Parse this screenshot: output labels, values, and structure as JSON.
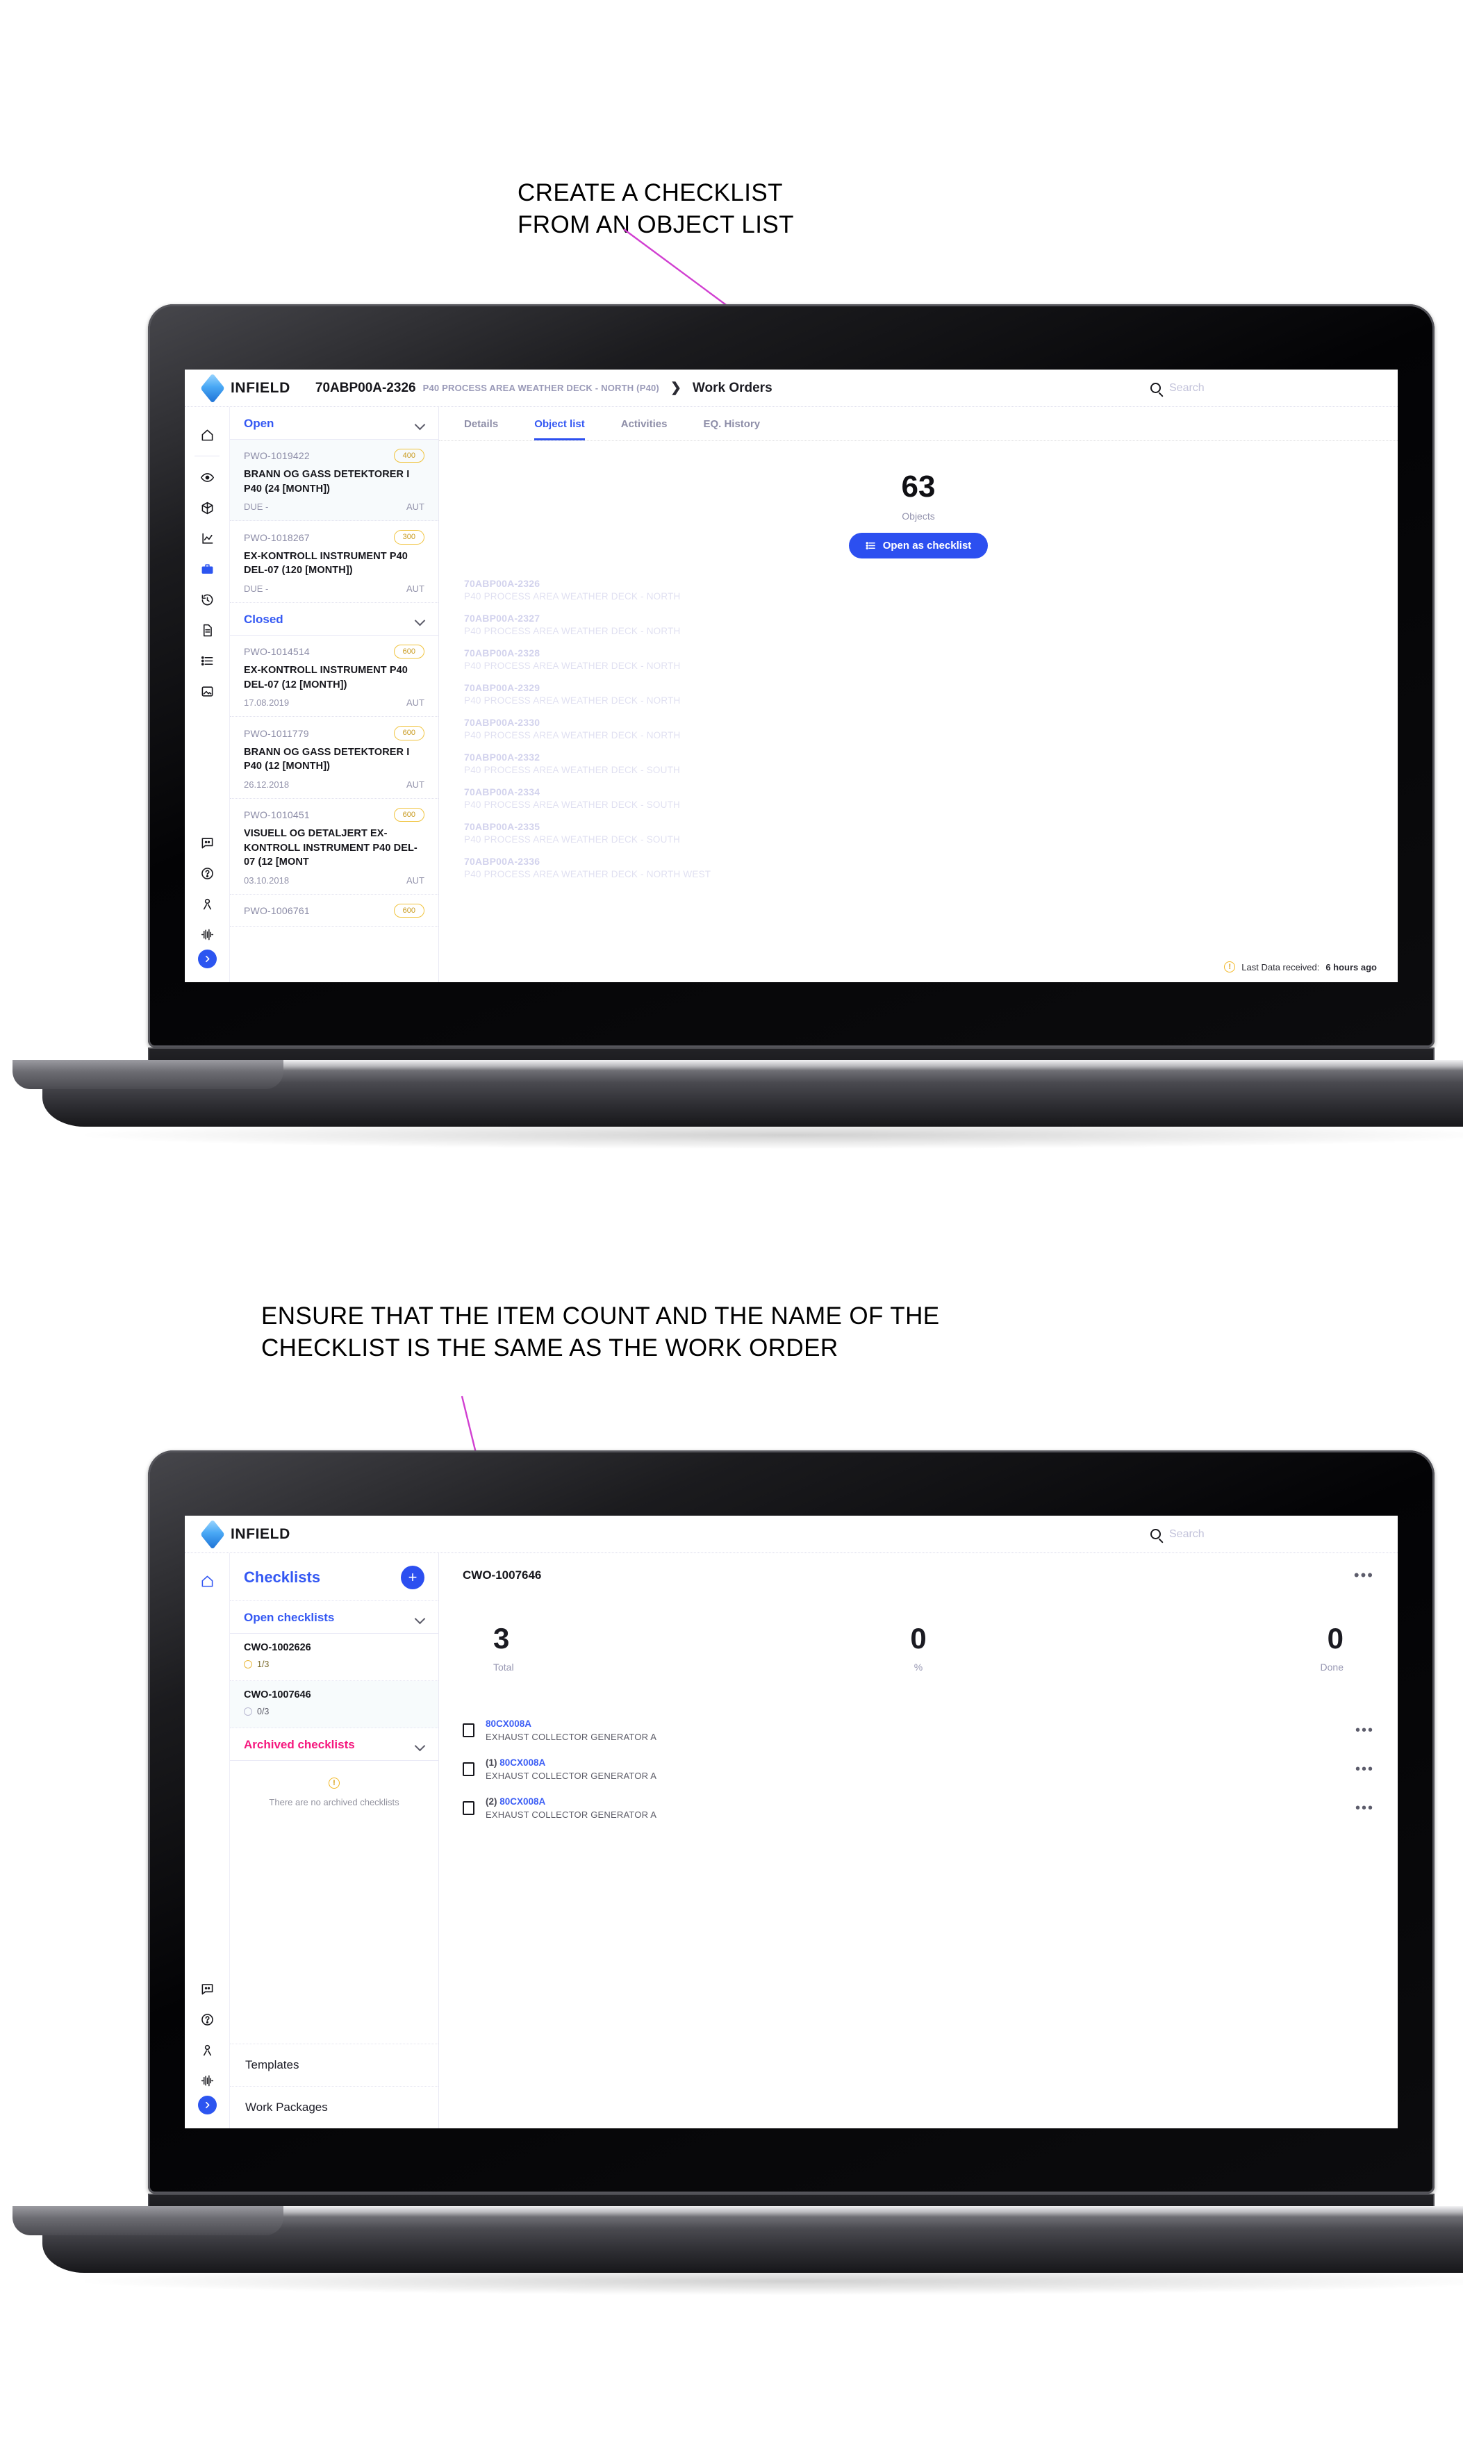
{
  "annotations": [
    {
      "id": "annotation-create-checklist",
      "text": "CREATE A CHECKLIST\nFROM AN OBJECT LIST",
      "color": "#d13fd1"
    },
    {
      "id": "annotation-item-count",
      "text": "ENSURE THAT THE ITEM COUNT AND THE NAME OF THE\nCHECKLIST IS THE SAME AS THE WORK ORDER",
      "color": "#d13fd1"
    }
  ],
  "screen1": {
    "appbar": {
      "logo_text": "INFIELD",
      "breadcrumb_code": "70ABP00A-2326",
      "breadcrumb_desc": "P40 PROCESS AREA WEATHER DECK - NORTH (P40)",
      "breadcrumb_sep": "❯",
      "breadcrumb_leaf": "Work Orders",
      "search_placeholder": "Search"
    },
    "rail": [
      {
        "name": "home-icon"
      },
      {
        "name": "eye-icon"
      },
      {
        "name": "cube-icon"
      },
      {
        "name": "chart-icon"
      },
      {
        "name": "toolbox-icon",
        "active": true
      },
      {
        "name": "history-icon"
      },
      {
        "name": "document-icon"
      },
      {
        "name": "list-icon"
      },
      {
        "name": "image-icon"
      },
      {
        "name": "message-icon"
      },
      {
        "name": "help-icon"
      },
      {
        "name": "person-icon"
      },
      {
        "name": "waveform-icon"
      },
      {
        "name": "collapse-icon"
      }
    ],
    "groups": [
      {
        "label": "Open",
        "id": "group-open"
      },
      {
        "label": "Closed",
        "id": "group-closed"
      }
    ],
    "work_orders_open": [
      {
        "id": "PWO-1019422",
        "badge": "400",
        "title": "BRANN OG GASS DETEKTORER I P40 (24 [MONTH])",
        "date": "DUE -",
        "aut": "AUT",
        "selected": true
      },
      {
        "id": "PWO-1018267",
        "badge": "300",
        "title": "EX-KONTROLL INSTRUMENT P40 DEL-07 (120 [MONTH])",
        "date": "DUE -",
        "aut": "AUT",
        "selected": false
      }
    ],
    "work_orders_closed": [
      {
        "id": "PWO-1014514",
        "badge": "600",
        "title": "EX-KONTROLL INSTRUMENT P40 DEL-07 (12 [MONTH])",
        "date": "17.08.2019",
        "aut": "AUT"
      },
      {
        "id": "PWO-1011779",
        "badge": "600",
        "title": "BRANN OG GASS DETEKTORER I P40 (12 [MONTH])",
        "date": "26.12.2018",
        "aut": "AUT"
      },
      {
        "id": "PWO-1010451",
        "badge": "600",
        "title": "VISUELL OG DETALJERT EX-KONTROLL INSTRUMENT P40 DEL-07 (12 [MONT",
        "date": "03.10.2018",
        "aut": "AUT"
      },
      {
        "id": "PWO-1006761",
        "badge": "600",
        "title": "",
        "date": "",
        "aut": ""
      }
    ],
    "tabs": [
      {
        "label": "Details",
        "active": false
      },
      {
        "label": "Object list",
        "active": true
      },
      {
        "label": "Activities",
        "active": false
      },
      {
        "label": "EQ. History",
        "active": false
      }
    ],
    "kpi": {
      "value": "63",
      "label": "Objects"
    },
    "primary_button": {
      "label": "Open as checklist",
      "icon": "list-icon"
    },
    "objects": [
      {
        "code": "70ABP00A-2326",
        "desc": "P40 PROCESS AREA WEATHER DECK - NORTH"
      },
      {
        "code": "70ABP00A-2327",
        "desc": "P40 PROCESS AREA WEATHER DECK - NORTH"
      },
      {
        "code": "70ABP00A-2328",
        "desc": "P40 PROCESS AREA WEATHER DECK - NORTH"
      },
      {
        "code": "70ABP00A-2329",
        "desc": "P40 PROCESS AREA WEATHER DECK - NORTH"
      },
      {
        "code": "70ABP00A-2330",
        "desc": "P40 PROCESS AREA WEATHER DECK - NORTH"
      },
      {
        "code": "70ABP00A-2332",
        "desc": "P40 PROCESS AREA WEATHER DECK - SOUTH"
      },
      {
        "code": "70ABP00A-2334",
        "desc": "P40 PROCESS AREA WEATHER DECK - SOUTH"
      },
      {
        "code": "70ABP00A-2335",
        "desc": "P40 PROCESS AREA WEATHER DECK - SOUTH"
      },
      {
        "code": "70ABP00A-2336",
        "desc": "P40 PROCESS AREA WEATHER DECK - NORTH WEST"
      }
    ],
    "status": {
      "prefix": "Last Data received:",
      "value": "6 hours ago",
      "icon": "warning-icon"
    }
  },
  "screen2": {
    "appbar": {
      "logo_text": "INFIELD",
      "search_placeholder": "Search"
    },
    "sidebar": {
      "title": "Checklists",
      "add_label": "+",
      "open_group": "Open checklists",
      "archived_group": "Archived checklists",
      "checklists": [
        {
          "id": "CWO-1002626",
          "progress": "1/3",
          "state": "partial",
          "selected": false
        },
        {
          "id": "CWO-1007646",
          "progress": "0/3",
          "state": "none",
          "selected": true
        }
      ],
      "archived_empty": "There are no archived checklists",
      "nav": [
        {
          "label": "Templates"
        },
        {
          "label": "Work Packages"
        }
      ]
    },
    "panel": {
      "checklist_id": "CWO-1007646",
      "menu_icon": "•••",
      "stats": [
        {
          "value": "3",
          "label": "Total"
        },
        {
          "value": "0",
          "label": "%"
        },
        {
          "value": "0",
          "label": "Done"
        }
      ],
      "items": [
        {
          "prefix": "",
          "code": "80CX008A",
          "desc": "EXHAUST COLLECTOR GENERATOR A"
        },
        {
          "prefix": "(1) ",
          "code": "80CX008A",
          "desc": "EXHAUST COLLECTOR GENERATOR A"
        },
        {
          "prefix": "(2) ",
          "code": "80CX008A",
          "desc": "EXHAUST COLLECTOR GENERATOR A"
        }
      ]
    }
  }
}
